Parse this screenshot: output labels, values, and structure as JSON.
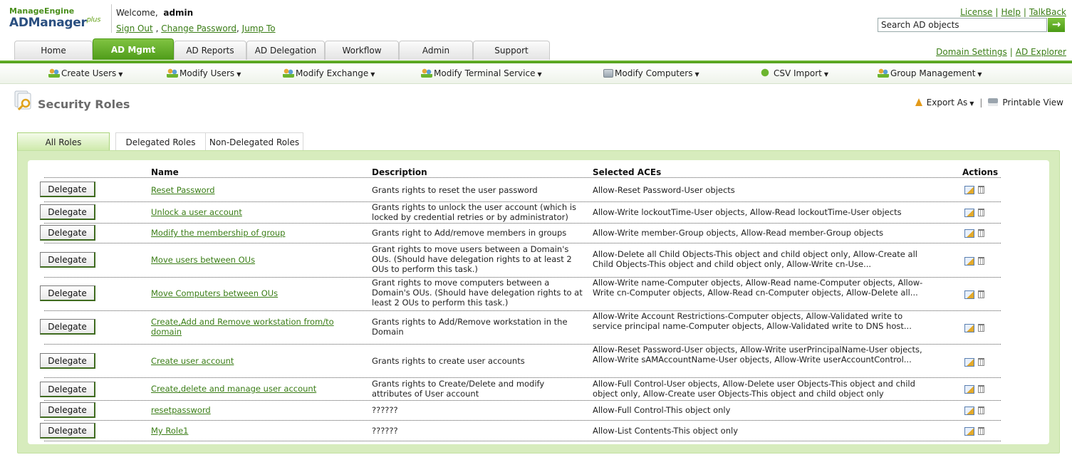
{
  "header": {
    "logo_top": "ManageEngine",
    "logo_main": "ADManager",
    "logo_plus": "plus",
    "welcome_label": "Welcome,",
    "username": "admin",
    "sign_out": "Sign Out",
    "change_password": "Change Password",
    "jump_to": "Jump To",
    "license": "License",
    "help": "Help",
    "talkback": "TalkBack",
    "search_placeholder": "Search AD objects",
    "search_button": "→"
  },
  "main_tabs": [
    {
      "label": "Home"
    },
    {
      "label": "AD Mgmt",
      "active": true
    },
    {
      "label": "AD Reports"
    },
    {
      "label": "AD Delegation"
    },
    {
      "label": "Workflow"
    },
    {
      "label": "Admin"
    },
    {
      "label": "Support"
    }
  ],
  "tab_links": {
    "domain_settings": "Domain Settings",
    "ad_explorer": "AD Explorer"
  },
  "submenu": [
    {
      "label": "Create Users"
    },
    {
      "label": "Modify Users"
    },
    {
      "label": "Modify Exchange"
    },
    {
      "label": "Modify Terminal Service"
    },
    {
      "label": "Modify Computers"
    },
    {
      "label": "CSV Import"
    },
    {
      "label": "Group Management"
    }
  ],
  "page": {
    "title": "Security Roles",
    "export_as": "Export As",
    "printable_view": "Printable View"
  },
  "role_tabs": [
    {
      "label": "All Roles",
      "active": true
    },
    {
      "label": "Delegated Roles"
    },
    {
      "label": "Non-Delegated Roles"
    }
  ],
  "table": {
    "headers": {
      "name": "Name",
      "description": "Description",
      "aces": "Selected ACEs",
      "actions": "Actions"
    },
    "delegate_label": "Delegate",
    "rows": [
      {
        "name": "Reset Password",
        "description": "Grants rights to reset the user password",
        "aces": "Allow-Reset Password-User objects"
      },
      {
        "name": "Unlock a user account",
        "description": "Grants rights to unlock the user account (which is locked by credential retries or by administrator)",
        "aces": "Allow-Write lockoutTime-User objects, Allow-Read lockoutTime-User objects"
      },
      {
        "name": "Modify the membership of group",
        "description": "Grants right to Add/remove members in groups",
        "aces": "Allow-Write member-Group objects, Allow-Read member-Group objects"
      },
      {
        "name": "Move users between OUs",
        "description": "Grant rights to move users between a Domain's OUs. (Should have delegation rights to at least 2 OUs to perform this task.)",
        "aces": "Allow-Delete all Child Objects-This object and child object only, Allow-Create all Child Objects-This object and child object only, Allow-Write cn-Use..."
      },
      {
        "name": "Move Computers between OUs",
        "description": "Grant rights to move computers between a Domain's OUs. (Should have delegation rights to at least 2 OUs to perform this task.)",
        "aces": "Allow-Write name-Computer objects, Allow-Read name-Computer objects, Allow-Write cn-Computer objects, Allow-Read cn-Computer objects, Allow-Delete all..."
      },
      {
        "name": "Create,Add and Remove workstation from/to domain",
        "description": "Grants rights to Add/Remove workstation in the Domain",
        "aces": "Allow-Write Account Restrictions-Computer objects, Allow-Validated write to service principal name-Computer objects, Allow-Validated write to DNS host..."
      },
      {
        "name": "Create user account",
        "description": "Grants rights to create user accounts",
        "aces": "Allow-Reset Password-User objects, Allow-Write userPrincipalName-User objects, Allow-Write sAMAccountName-User objects, Allow-Write userAccountControl..."
      },
      {
        "name": "Create,delete and manage user account",
        "description": "Grants rights to Create/Delete and modify attributes of User account",
        "aces": "Allow-Full Control-User objects, Allow-Delete user Objects-This object and child object only, Allow-Create user Objects-This object and child object only"
      },
      {
        "name": "resetpassword",
        "description": "??????",
        "aces": "Allow-Full Control-This object only"
      },
      {
        "name": "My Role1",
        "description": "??????",
        "aces": "Allow-List Contents-This object only"
      }
    ]
  }
}
